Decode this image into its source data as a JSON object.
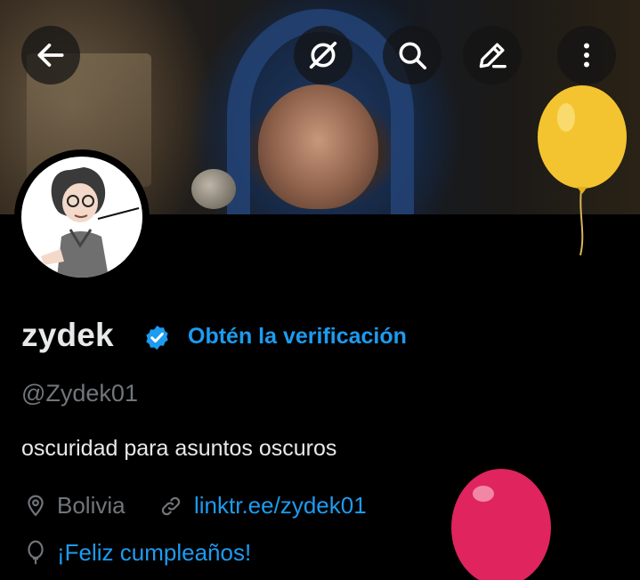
{
  "header": {
    "back_icon": "arrow-left-icon",
    "actions": [
      "no-signal-icon",
      "search-icon",
      "edit-icon",
      "more-vertical-icon"
    ]
  },
  "profile": {
    "display_name": "zydek",
    "verified_icon": "verified-badge-icon",
    "verified_color": "#1d9bf0",
    "get_verified_label": "Obtén la verificación",
    "handle": "@Zydek01",
    "bio": "oscuridad para asuntos oscuros",
    "location": "Bolivia",
    "website": "linktr.ee/zydek01",
    "birthday": "¡Feliz cumpleaños!"
  },
  "colors": {
    "accent": "#1d9bf0",
    "muted": "#71767b",
    "text": "#e7e9ea",
    "balloon_yellow": "#f4c430",
    "balloon_red": "#e0245e"
  }
}
